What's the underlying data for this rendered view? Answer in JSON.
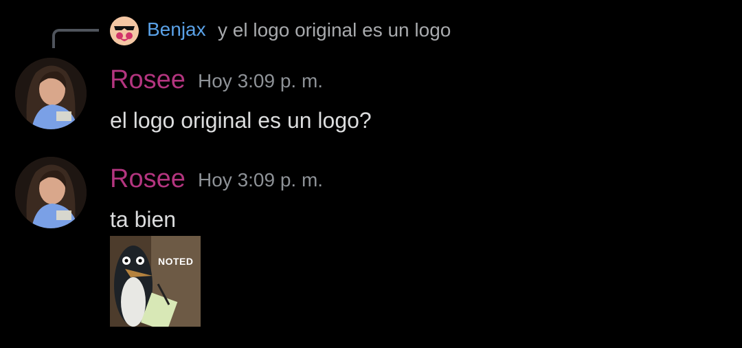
{
  "reply": {
    "author": "Benjax",
    "preview_text": "y el logo original es un logo",
    "avatar_icon": "sunglasses-emoji-avatar",
    "author_color": "#5aa2e8"
  },
  "messages": [
    {
      "author": "Rosee",
      "timestamp": "Hoy 3:09 p. m.",
      "content": "el logo original es un logo?",
      "author_color": "#b3357f"
    },
    {
      "author": "Rosee",
      "timestamp": "Hoy 3:09 p. m.",
      "content": "ta bien",
      "author_color": "#b3357f",
      "sticker": {
        "caption": "NOTED",
        "icon": "penguin-noted-sticker"
      }
    }
  ]
}
